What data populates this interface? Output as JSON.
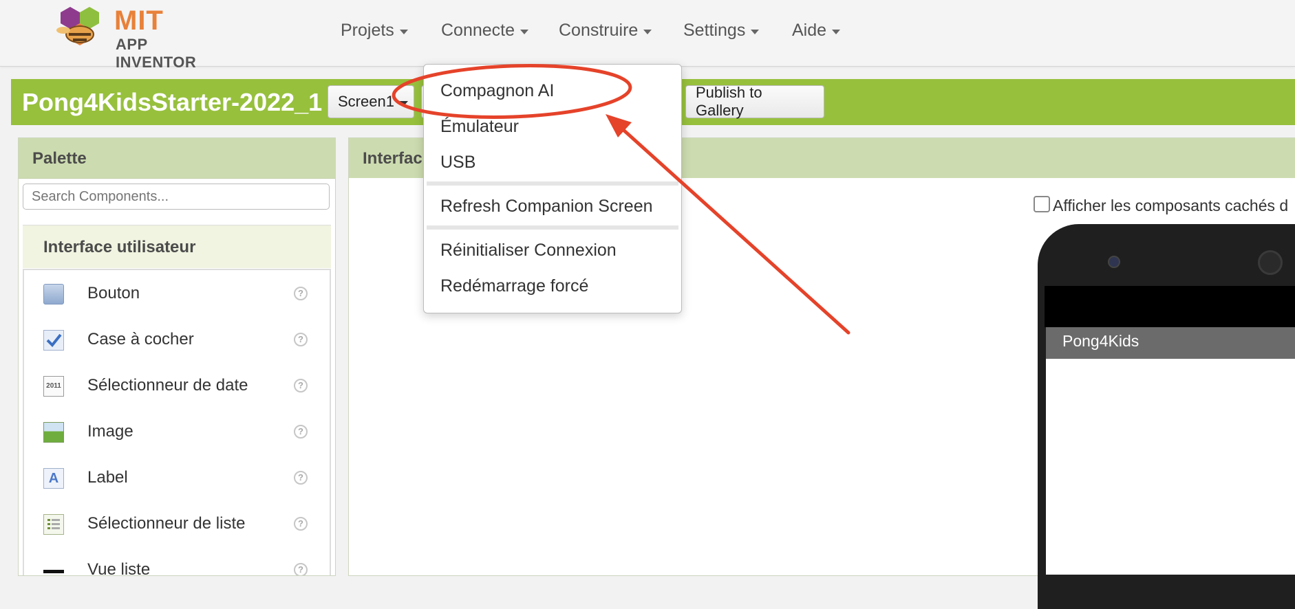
{
  "logo": {
    "line1": "MIT",
    "line2": "APP INVENTOR"
  },
  "nav": [
    {
      "label": "Projets"
    },
    {
      "label": "Connecte"
    },
    {
      "label": "Construire"
    },
    {
      "label": "Settings"
    },
    {
      "label": "Aide"
    }
  ],
  "project": {
    "name": "Pong4KidsStarter-2022_1",
    "screen_button": "Screen1",
    "publish_button": "Publish to Gallery"
  },
  "palette": {
    "title": "Palette",
    "search_placeholder": "Search Components...",
    "section": "Interface utilisateur",
    "items": [
      {
        "label": "Bouton",
        "icon": "button-icon"
      },
      {
        "label": "Case à cocher",
        "icon": "checkbox-icon"
      },
      {
        "label": "Sélectionneur de date",
        "icon": "calendar-icon"
      },
      {
        "label": "Image",
        "icon": "image-icon"
      },
      {
        "label": "Label",
        "icon": "label-icon"
      },
      {
        "label": "Sélectionneur de liste",
        "icon": "list-picker-icon"
      },
      {
        "label": "Vue liste",
        "icon": "list-view-icon"
      }
    ],
    "help_glyph": "?"
  },
  "viewer": {
    "title": "Interfac",
    "hidden_components_label": "Afficher les composants cachés d",
    "phone_title": "Pong4Kids"
  },
  "connect_menu": {
    "items": [
      "Compagnon AI",
      "Émulateur",
      "USB",
      "Refresh Companion Screen",
      "Réinitialiser Connexion",
      "Redémarrage forcé"
    ]
  },
  "colors": {
    "project_bar": "#97c03d",
    "panel_header": "#cddcb0",
    "annotation": "#e5432a",
    "logo_orange": "#e8813a"
  }
}
